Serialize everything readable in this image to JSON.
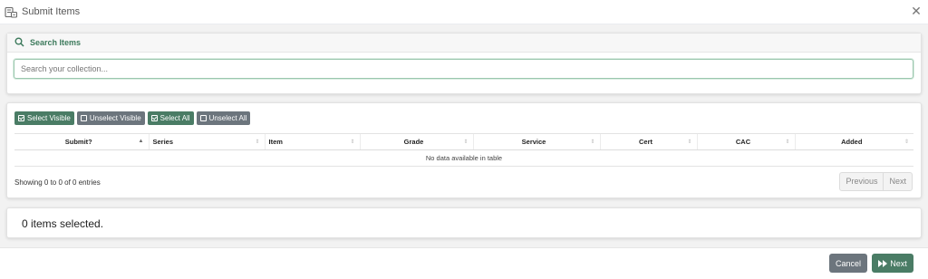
{
  "header": {
    "title": "Submit Items",
    "close_icon": "close-icon",
    "title_icon": "database-box-icon"
  },
  "search": {
    "title": "Search Items",
    "icon": "search-icon",
    "placeholder": "Search your collection...",
    "value": ""
  },
  "toolbar": {
    "buttons": [
      {
        "label": "Select Visible",
        "style": "green",
        "checked": true
      },
      {
        "label": "Unselect Visible",
        "style": "grey",
        "checked": false
      },
      {
        "label": "Select All",
        "style": "green",
        "checked": true
      },
      {
        "label": "Unselect All",
        "style": "grey",
        "checked": false
      }
    ]
  },
  "table": {
    "columns": [
      "Submit?",
      "Series",
      "Item",
      "Grade",
      "Service",
      "Cert",
      "CAC",
      "Added"
    ],
    "empty_message": "No data available in table",
    "info": "Showing 0 to 0 of 0 entries",
    "pager": {
      "previous": "Previous",
      "next": "Next"
    }
  },
  "selection": {
    "text": "0 items selected."
  },
  "footer": {
    "cancel_label": "Cancel",
    "next_label": "Next",
    "next_icon": "fast-forward-icon"
  },
  "colors": {
    "accent": "#4a7c65",
    "secondary": "#6c757d"
  }
}
